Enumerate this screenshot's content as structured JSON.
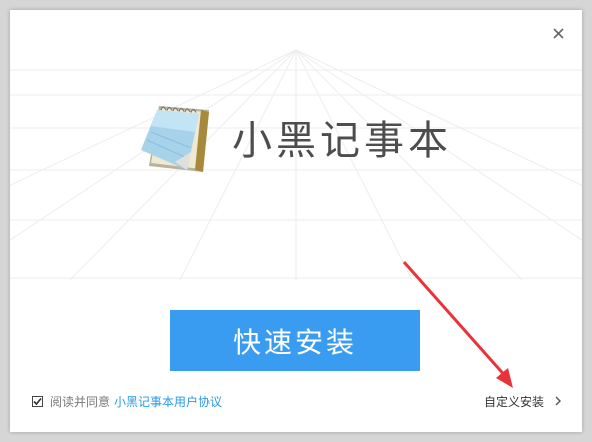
{
  "window": {
    "close_icon": "close-icon"
  },
  "hero": {
    "logo_icon": "notepad-icon",
    "title": "小黑记事本"
  },
  "install_button": {
    "label": "快速安装"
  },
  "agreement": {
    "checked": true,
    "text": "阅读并同意",
    "link_label": "小黑记事本用户协议"
  },
  "custom_install": {
    "label": "自定义安装",
    "chevron_icon": "chevron-right-icon"
  },
  "colors": {
    "primary": "#3a9cf0",
    "link": "#2b9ae6",
    "annotation_arrow": "#e8333a"
  }
}
